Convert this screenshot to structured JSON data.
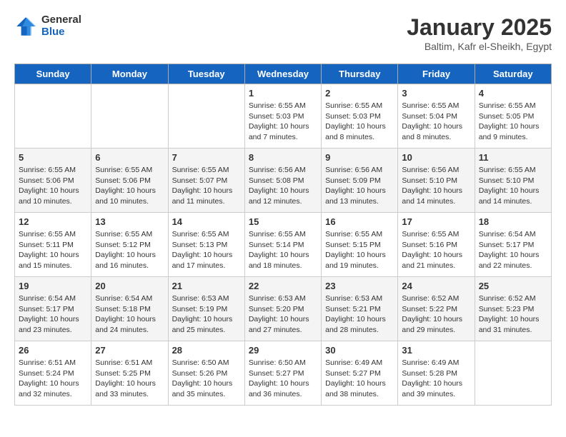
{
  "header": {
    "logo_general": "General",
    "logo_blue": "Blue",
    "title": "January 2025",
    "subtitle": "Baltim, Kafr el-Sheikh, Egypt"
  },
  "days_of_week": [
    "Sunday",
    "Monday",
    "Tuesday",
    "Wednesday",
    "Thursday",
    "Friday",
    "Saturday"
  ],
  "weeks": [
    [
      {
        "date": "",
        "info": ""
      },
      {
        "date": "",
        "info": ""
      },
      {
        "date": "",
        "info": ""
      },
      {
        "date": "1",
        "info": "Sunrise: 6:55 AM\nSunset: 5:03 PM\nDaylight: 10 hours\nand 7 minutes."
      },
      {
        "date": "2",
        "info": "Sunrise: 6:55 AM\nSunset: 5:03 PM\nDaylight: 10 hours\nand 8 minutes."
      },
      {
        "date": "3",
        "info": "Sunrise: 6:55 AM\nSunset: 5:04 PM\nDaylight: 10 hours\nand 8 minutes."
      },
      {
        "date": "4",
        "info": "Sunrise: 6:55 AM\nSunset: 5:05 PM\nDaylight: 10 hours\nand 9 minutes."
      }
    ],
    [
      {
        "date": "5",
        "info": "Sunrise: 6:55 AM\nSunset: 5:06 PM\nDaylight: 10 hours\nand 10 minutes."
      },
      {
        "date": "6",
        "info": "Sunrise: 6:55 AM\nSunset: 5:06 PM\nDaylight: 10 hours\nand 10 minutes."
      },
      {
        "date": "7",
        "info": "Sunrise: 6:55 AM\nSunset: 5:07 PM\nDaylight: 10 hours\nand 11 minutes."
      },
      {
        "date": "8",
        "info": "Sunrise: 6:56 AM\nSunset: 5:08 PM\nDaylight: 10 hours\nand 12 minutes."
      },
      {
        "date": "9",
        "info": "Sunrise: 6:56 AM\nSunset: 5:09 PM\nDaylight: 10 hours\nand 13 minutes."
      },
      {
        "date": "10",
        "info": "Sunrise: 6:56 AM\nSunset: 5:10 PM\nDaylight: 10 hours\nand 14 minutes."
      },
      {
        "date": "11",
        "info": "Sunrise: 6:55 AM\nSunset: 5:10 PM\nDaylight: 10 hours\nand 14 minutes."
      }
    ],
    [
      {
        "date": "12",
        "info": "Sunrise: 6:55 AM\nSunset: 5:11 PM\nDaylight: 10 hours\nand 15 minutes."
      },
      {
        "date": "13",
        "info": "Sunrise: 6:55 AM\nSunset: 5:12 PM\nDaylight: 10 hours\nand 16 minutes."
      },
      {
        "date": "14",
        "info": "Sunrise: 6:55 AM\nSunset: 5:13 PM\nDaylight: 10 hours\nand 17 minutes."
      },
      {
        "date": "15",
        "info": "Sunrise: 6:55 AM\nSunset: 5:14 PM\nDaylight: 10 hours\nand 18 minutes."
      },
      {
        "date": "16",
        "info": "Sunrise: 6:55 AM\nSunset: 5:15 PM\nDaylight: 10 hours\nand 19 minutes."
      },
      {
        "date": "17",
        "info": "Sunrise: 6:55 AM\nSunset: 5:16 PM\nDaylight: 10 hours\nand 21 minutes."
      },
      {
        "date": "18",
        "info": "Sunrise: 6:54 AM\nSunset: 5:17 PM\nDaylight: 10 hours\nand 22 minutes."
      }
    ],
    [
      {
        "date": "19",
        "info": "Sunrise: 6:54 AM\nSunset: 5:17 PM\nDaylight: 10 hours\nand 23 minutes."
      },
      {
        "date": "20",
        "info": "Sunrise: 6:54 AM\nSunset: 5:18 PM\nDaylight: 10 hours\nand 24 minutes."
      },
      {
        "date": "21",
        "info": "Sunrise: 6:53 AM\nSunset: 5:19 PM\nDaylight: 10 hours\nand 25 minutes."
      },
      {
        "date": "22",
        "info": "Sunrise: 6:53 AM\nSunset: 5:20 PM\nDaylight: 10 hours\nand 27 minutes."
      },
      {
        "date": "23",
        "info": "Sunrise: 6:53 AM\nSunset: 5:21 PM\nDaylight: 10 hours\nand 28 minutes."
      },
      {
        "date": "24",
        "info": "Sunrise: 6:52 AM\nSunset: 5:22 PM\nDaylight: 10 hours\nand 29 minutes."
      },
      {
        "date": "25",
        "info": "Sunrise: 6:52 AM\nSunset: 5:23 PM\nDaylight: 10 hours\nand 31 minutes."
      }
    ],
    [
      {
        "date": "26",
        "info": "Sunrise: 6:51 AM\nSunset: 5:24 PM\nDaylight: 10 hours\nand 32 minutes."
      },
      {
        "date": "27",
        "info": "Sunrise: 6:51 AM\nSunset: 5:25 PM\nDaylight: 10 hours\nand 33 minutes."
      },
      {
        "date": "28",
        "info": "Sunrise: 6:50 AM\nSunset: 5:26 PM\nDaylight: 10 hours\nand 35 minutes."
      },
      {
        "date": "29",
        "info": "Sunrise: 6:50 AM\nSunset: 5:27 PM\nDaylight: 10 hours\nand 36 minutes."
      },
      {
        "date": "30",
        "info": "Sunrise: 6:49 AM\nSunset: 5:27 PM\nDaylight: 10 hours\nand 38 minutes."
      },
      {
        "date": "31",
        "info": "Sunrise: 6:49 AM\nSunset: 5:28 PM\nDaylight: 10 hours\nand 39 minutes."
      },
      {
        "date": "",
        "info": ""
      }
    ]
  ]
}
